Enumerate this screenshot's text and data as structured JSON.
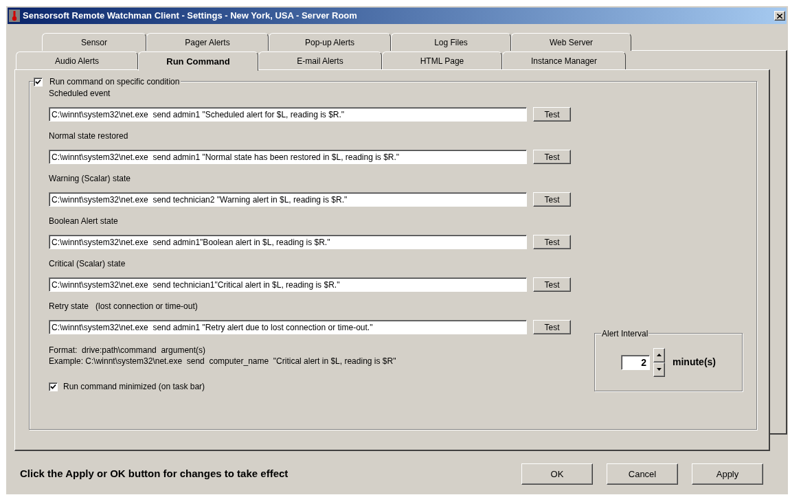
{
  "window": {
    "title": "Sensorsoft Remote Watchman Client - Settings - New York, USA - Server Room"
  },
  "tab_rows": [
    [
      {
        "label": "Sensor",
        "selected": false
      },
      {
        "label": "Pager Alerts",
        "selected": false
      },
      {
        "label": "Pop-up Alerts",
        "selected": false
      },
      {
        "label": "Log Files",
        "selected": false
      },
      {
        "label": "Web Server",
        "selected": false
      }
    ],
    [
      {
        "label": "Audio Alerts",
        "selected": false
      },
      {
        "label": "Run Command",
        "selected": true
      },
      {
        "label": "E-mail Alerts",
        "selected": false
      },
      {
        "label": "HTML Page",
        "selected": false
      },
      {
        "label": "Instance Manager",
        "selected": false
      }
    ]
  ],
  "group": {
    "label": "Run command on specific condition",
    "checked": true
  },
  "commands": [
    {
      "label": "Scheduled event",
      "value": "C:\\winnt\\system32\\net.exe  send admin1 \"Scheduled alert for $L, reading is $R.\"",
      "button": "Test"
    },
    {
      "label": "Normal state restored",
      "value": "C:\\winnt\\system32\\net.exe  send admin1 \"Normal state has been restored in $L, reading is $R.\"",
      "button": "Test"
    },
    {
      "label": "Warning (Scalar) state",
      "value": "C:\\winnt\\system32\\net.exe  send technician2 \"Warning alert in $L, reading is $R.\"",
      "button": "Test"
    },
    {
      "label": "Boolean Alert state",
      "value": "C:\\winnt\\system32\\net.exe  send admin1\"Boolean alert in $L, reading is $R.\"",
      "button": "Test"
    },
    {
      "label": "Critical (Scalar) state",
      "value": "C:\\winnt\\system32\\net.exe  send technician1\"Critical alert in $L, reading is $R.\"",
      "button": "Test"
    },
    {
      "label": "Retry state   (lost connection or time-out)",
      "value": "C:\\winnt\\system32\\net.exe  send admin1 \"Retry alert due to lost connection or time-out.\"",
      "button": "Test"
    }
  ],
  "format_note": "Format:  drive:path\\command  argument(s)",
  "example_note": "Example: C:\\winnt\\system32\\net.exe  send  computer_name  \"Critical alert in $L, reading is $R\"",
  "minimized": {
    "label": "Run command minimized (on task bar)",
    "checked": true
  },
  "alert_interval": {
    "label": "Alert Interval",
    "value": "2",
    "unit": "minute(s)"
  },
  "footer": {
    "hint": "Click the Apply or OK button for changes to take effect",
    "buttons": [
      "OK",
      "Cancel",
      "Apply"
    ]
  }
}
